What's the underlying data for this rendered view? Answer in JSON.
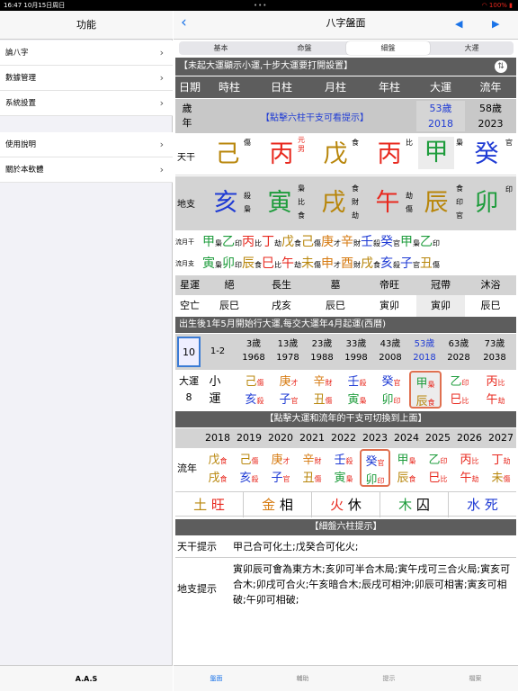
{
  "status": {
    "time": "16:47",
    "date": "10月15日周日",
    "battery": "100%",
    "dots": "•••"
  },
  "sidebar": {
    "title": "功能",
    "items": [
      {
        "label": "論八字"
      },
      {
        "label": "數據管理"
      },
      {
        "label": "系統設置"
      },
      {
        "label": "使用說明"
      },
      {
        "label": "關於本軟體"
      }
    ],
    "footer": "A.A.S"
  },
  "header": {
    "title": "八字盤面",
    "back": "‹",
    "prev": "◀",
    "next": "▶"
  },
  "segments": [
    "基本",
    "命盤",
    "細盤",
    "大運"
  ],
  "bar1": "【未起大運顯示小運,十步大運要打開設置】",
  "cols": [
    "日期",
    "時柱",
    "日柱",
    "月柱",
    "年柱",
    "大運",
    "流年"
  ],
  "age_label": "歲年",
  "hint1": "【點擊六柱干支可看提示】",
  "dayun_age": "53歲",
  "dayun_year": "2018",
  "liunian_age": "58歲",
  "liunian_year": "2023",
  "tiangan": {
    "label": "天干",
    "chars": [
      "己",
      "丙",
      "戊",
      "丙",
      "甲",
      "癸"
    ],
    "god": [
      "傷",
      "元男",
      "食",
      "比",
      "梟",
      "官"
    ]
  },
  "dizhi": {
    "label": "地支",
    "chars": [
      "亥",
      "寅",
      "戌",
      "午",
      "辰",
      "卯"
    ],
    "gods": [
      [
        "殺",
        "梟"
      ],
      [
        "梟",
        "比",
        "食"
      ],
      [
        "食",
        "財",
        "劫"
      ],
      [
        "劫",
        "傷"
      ],
      [
        "食",
        "印",
        "官"
      ],
      [
        "印"
      ]
    ]
  },
  "liuyue_gan": {
    "label": "流月干",
    "items": [
      [
        "甲",
        "梟"
      ],
      [
        "乙",
        "印"
      ],
      [
        "丙",
        "比"
      ],
      [
        "丁",
        "劫"
      ],
      [
        "戊",
        "食"
      ],
      [
        "己",
        "傷"
      ],
      [
        "庚",
        "才"
      ],
      [
        "辛",
        "財"
      ],
      [
        "壬",
        "殺"
      ],
      [
        "癸",
        "官"
      ],
      [
        "甲",
        "梟"
      ],
      [
        "乙",
        "印"
      ]
    ]
  },
  "liuyue_zhi": {
    "label": "流月支",
    "items": [
      [
        "寅",
        "梟"
      ],
      [
        "卯",
        "印"
      ],
      [
        "辰",
        "食"
      ],
      [
        "巳",
        "比"
      ],
      [
        "午",
        "劫"
      ],
      [
        "未",
        "傷"
      ],
      [
        "申",
        "才"
      ],
      [
        "酉",
        "財"
      ],
      [
        "戌",
        "食"
      ],
      [
        "亥",
        "殺"
      ],
      [
        "子",
        "官"
      ],
      [
        "丑",
        "傷"
      ]
    ]
  },
  "xingyun": {
    "label": "星運",
    "items": [
      "絕",
      "長生",
      "墓",
      "帝旺",
      "冠帶",
      "沐浴"
    ]
  },
  "kongwang": {
    "label": "空亡",
    "items": [
      "辰巳",
      "戌亥",
      "辰巳",
      "寅卯",
      "寅卯",
      "辰巳"
    ]
  },
  "bar2": "出生後1年5月開始行大運,每交大運年4月起運(西曆)",
  "dayun_ages": [
    {
      "a": "10",
      "y": ""
    },
    {
      "a": "1-2",
      "y": ""
    },
    {
      "a": "3歲",
      "y": "1968"
    },
    {
      "a": "13歲",
      "y": "1978"
    },
    {
      "a": "23歲",
      "y": "1988"
    },
    {
      "a": "33歲",
      "y": "1998"
    },
    {
      "a": "43歲",
      "y": "2008"
    },
    {
      "a": "53歲",
      "y": "2018"
    },
    {
      "a": "63歲",
      "y": "2028"
    },
    {
      "a": "73歲",
      "y": "2038"
    }
  ],
  "dayun_label": "大運8",
  "dayun_gz": [
    [
      "小",
      "運",
      "",
      ""
    ],
    [
      "己",
      "亥",
      "傷",
      "殺"
    ],
    [
      "庚",
      "子",
      "才",
      "官"
    ],
    [
      "辛",
      "丑",
      "財",
      "傷"
    ],
    [
      "壬",
      "寅",
      "殺",
      "梟"
    ],
    [
      "癸",
      "卯",
      "官",
      "印"
    ],
    [
      "甲",
      "辰",
      "梟",
      "食"
    ],
    [
      "乙",
      "巳",
      "印",
      "比"
    ],
    [
      "丙",
      "午",
      "比",
      "劫"
    ]
  ],
  "bar3": "【點擊大運和流年的干支可切換到上面】",
  "ln_years": [
    "2018",
    "2019",
    "2020",
    "2021",
    "2022",
    "2023",
    "2024",
    "2025",
    "2026",
    "2027"
  ],
  "ln_label": "流年",
  "ln_gz": [
    [
      "戊",
      "戌",
      "食",
      "食"
    ],
    [
      "己",
      "亥",
      "傷",
      "殺"
    ],
    [
      "庚",
      "子",
      "才",
      "官"
    ],
    [
      "辛",
      "丑",
      "財",
      "傷"
    ],
    [
      "壬",
      "寅",
      "殺",
      "梟"
    ],
    [
      "癸",
      "卯",
      "官",
      "印"
    ],
    [
      "甲",
      "辰",
      "梟",
      "食"
    ],
    [
      "乙",
      "巳",
      "印",
      "比"
    ],
    [
      "丙",
      "午",
      "比",
      "劫"
    ],
    [
      "丁",
      "未",
      "劫",
      "傷"
    ]
  ],
  "wuxing": [
    [
      "土",
      "旺"
    ],
    [
      "金",
      "相"
    ],
    [
      "火",
      "休"
    ],
    [
      "木",
      "囚"
    ],
    [
      "水",
      "死"
    ]
  ],
  "bar4": "【細盤六柱提示】",
  "tg_hint_label": "天干提示",
  "tg_hint": "甲己合可化土;戊癸合可化火;",
  "dz_hint_label": "地支提示",
  "dz_hint": "寅卯辰可會為東方木;亥卯可半合木局;寅午戌可三合火局;寅亥可合木;卯戌可合火;午亥暗合木;辰戌可相沖;卯辰可相害;寅亥可相破;午卯可相破;",
  "tabs": [
    "盤面",
    "輔助",
    "提示",
    "檔案"
  ]
}
